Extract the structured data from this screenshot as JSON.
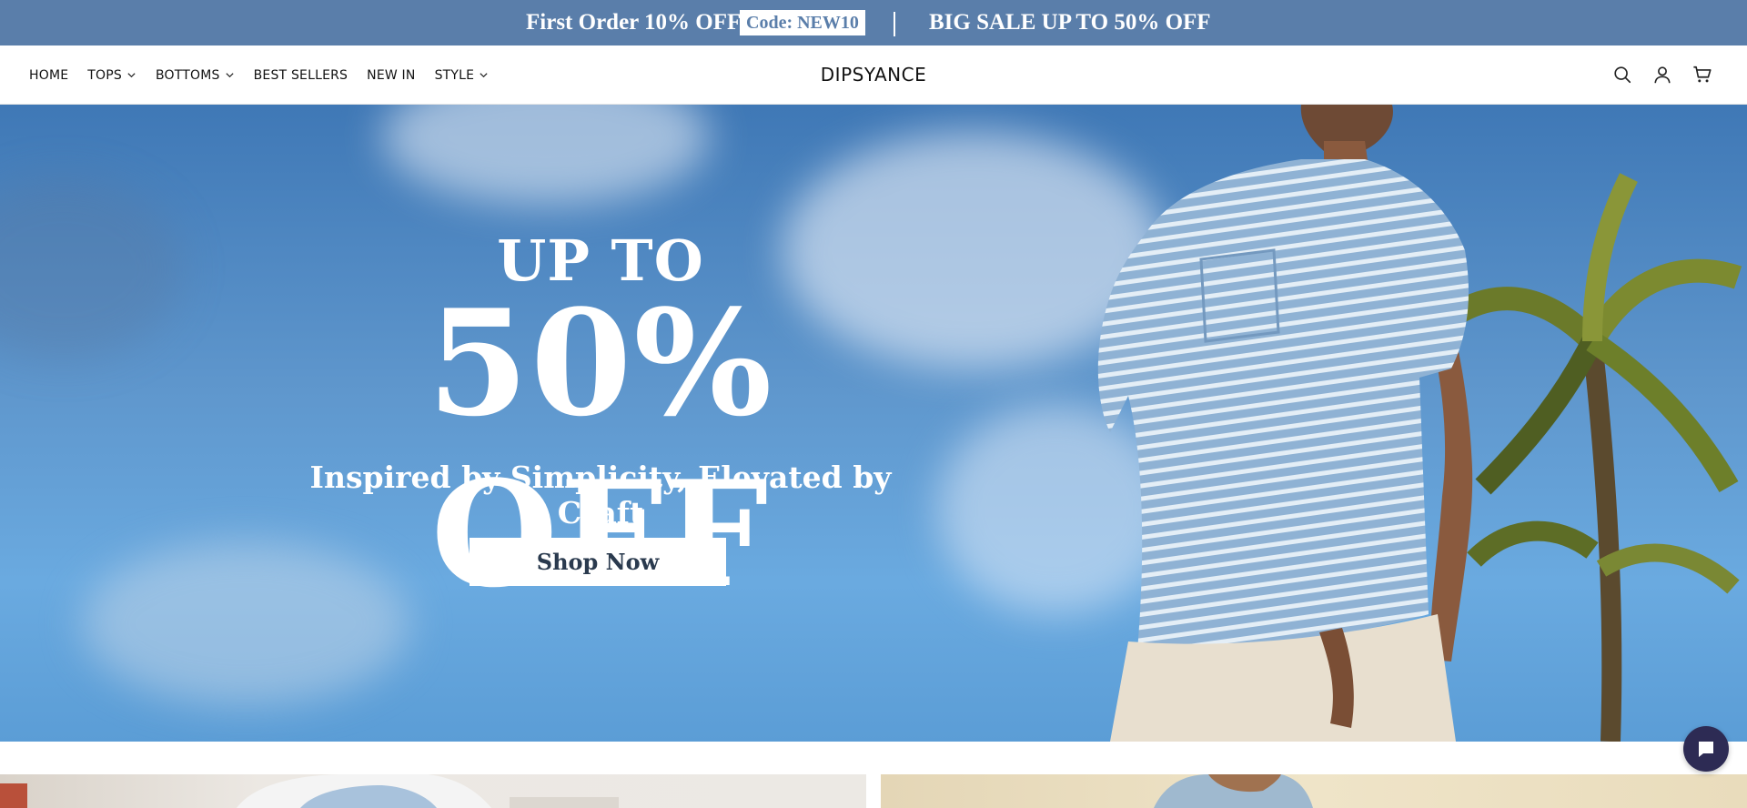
{
  "announcement": {
    "left_text": "First Order 10% OFF",
    "code": "Code: NEW10",
    "right_text": "BIG SALE UP TO 50% OFF",
    "background_color": "#5a7eaa"
  },
  "header": {
    "logo": "DIPSYANCE",
    "nav": [
      {
        "label": "HOME",
        "has_dropdown": false
      },
      {
        "label": "TOPS",
        "has_dropdown": true
      },
      {
        "label": "BOTTOMS",
        "has_dropdown": true
      },
      {
        "label": "BEST SELLERS",
        "has_dropdown": false
      },
      {
        "label": "NEW IN",
        "has_dropdown": false
      },
      {
        "label": "STYLE",
        "has_dropdown": true
      }
    ],
    "icons": [
      "search-icon",
      "account-icon",
      "cart-icon"
    ]
  },
  "hero": {
    "line1": "UP TO",
    "line2": "50% OFF",
    "subtitle": "Inspired by Simplicity, Elevated by Craft",
    "button_label": "Shop Now"
  },
  "chat": {
    "icon": "chat-icon",
    "color": "#2d2b54"
  }
}
